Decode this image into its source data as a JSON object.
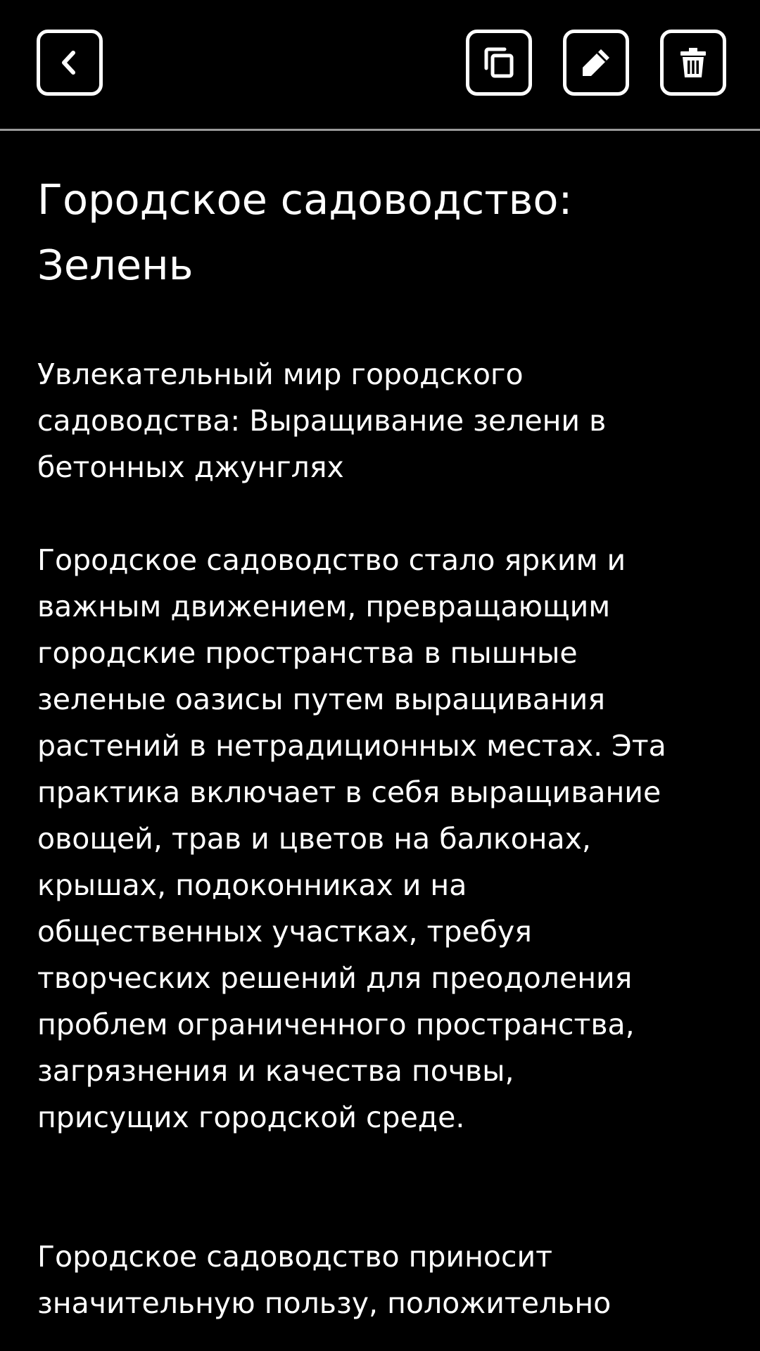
{
  "toolbar": {
    "back_icon": "chevron-left-icon",
    "copy_icon": "copy-icon",
    "edit_icon": "pencil-icon",
    "delete_icon": "trash-icon"
  },
  "note": {
    "title": "Городское садоводство:\nЗелень",
    "body": "Увлекательный мир городского\nсадоводства: Выращивание зелени в\nбетонных джунглях\n\nГородское садоводство стало ярким и\nважным движением, превращающим\nгородские пространства в пышные\nзеленые оазисы путем выращивания\nрастений в нетрадиционных местах. Эта\nпрактика включает в себя выращивание\nовощей, трав и цветов на балконах,\nкрышах, подоконниках и на\nобщественных участках, требуя\nтворческих решений для преодоления\nпроблем ограниченного пространства,\nзагрязнения и качества почвы,\nприсущих городской среде.\n\n\nГородское садоводство приносит\nзначительную пользу, положительно\nвлияя на окружающую среду, здоровье"
  },
  "colors": {
    "background": "#000000",
    "foreground": "#ffffff",
    "divider": "#9a9a9a"
  }
}
